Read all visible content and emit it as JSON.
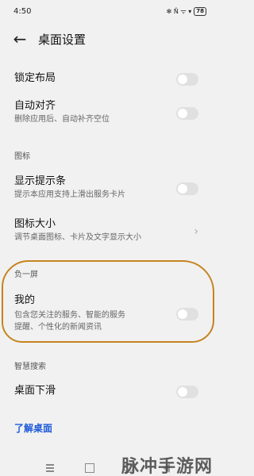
{
  "status_bar": {
    "time": "4:50",
    "icons": "✻ Ň ᯤ ▾",
    "battery": "78"
  },
  "header": {
    "title": "桌面设置"
  },
  "rows": {
    "lock_layout": {
      "title": "锁定布局"
    },
    "auto_align": {
      "title": "自动对齐",
      "sub": "删除应用后、自动补齐空位"
    },
    "show_bar": {
      "title": "显示提示条",
      "sub": "提示本应用支持上滑出服务卡片"
    },
    "icon_size": {
      "title": "图标大小",
      "sub": "调节桌面图标、卡片及文字显示大小"
    },
    "mine": {
      "title": "我的",
      "sub1": "包含您关注的服务、智能的服务",
      "sub2": "提醒、个性化的新闻资讯"
    },
    "desktop_swipe": {
      "title": "桌面下滑"
    }
  },
  "sections": {
    "icon": "图标",
    "minus_one": "负一屏",
    "smart_search": "智慧搜索"
  },
  "link": {
    "learn_desktop": "了解桌面"
  },
  "watermark": "脉冲手游网",
  "colors": {
    "accent": "#1e5bd8",
    "highlight": "#c5841f",
    "toggle_off": "#e0e0e0"
  }
}
